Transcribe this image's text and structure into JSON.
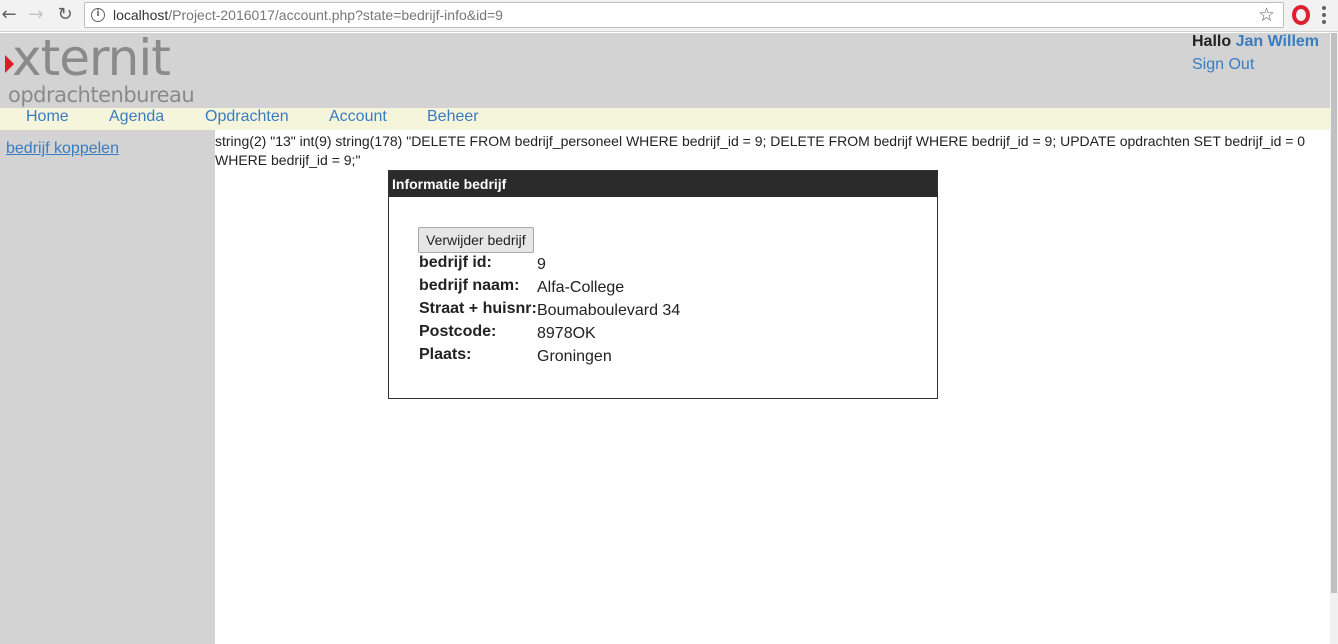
{
  "browser": {
    "url_host": "localhost",
    "url_path": "/Project-2016017/account.php?state=bedrijf-info&id=9"
  },
  "header": {
    "logo_main": "xternit",
    "logo_sub": "opdrachtenbureau",
    "greeting": "Hallo",
    "user_name": "Jan Willem",
    "sign_out": "Sign Out"
  },
  "nav": {
    "items": [
      "Home",
      "Agenda",
      "Opdrachten",
      "Account",
      "Beheer"
    ]
  },
  "sidebar": {
    "link": "bedrijf koppelen"
  },
  "debug_output": "string(2) \"13\" int(9) string(178) \"DELETE FROM bedrijf_personeel WHERE bedrijf_id = 9; DELETE FROM bedrijf WHERE bedrijf_id = 9; UPDATE opdrachten SET bedrijf_id = 0 WHERE bedrijf_id = 9;\"",
  "panel": {
    "title": "Informatie bedrijf",
    "delete_button": "Verwijder bedrijf",
    "rows": [
      {
        "label": "bedrijf id:",
        "value": "9"
      },
      {
        "label": "bedrijf naam:",
        "value": "Alfa-College"
      },
      {
        "label": "Straat + huisnr:",
        "value": "Boumaboulevard 34"
      },
      {
        "label": "Postcode:",
        "value": "8978OK"
      },
      {
        "label": "Plaats:",
        "value": "Groningen"
      }
    ]
  },
  "colors": {
    "link": "#3a7cc2",
    "header_bg": "#d3d3d3",
    "nav_bg": "#f5f5dc",
    "panel_title_bg": "#2b2b2b",
    "logo_accent": "#d81f26"
  }
}
